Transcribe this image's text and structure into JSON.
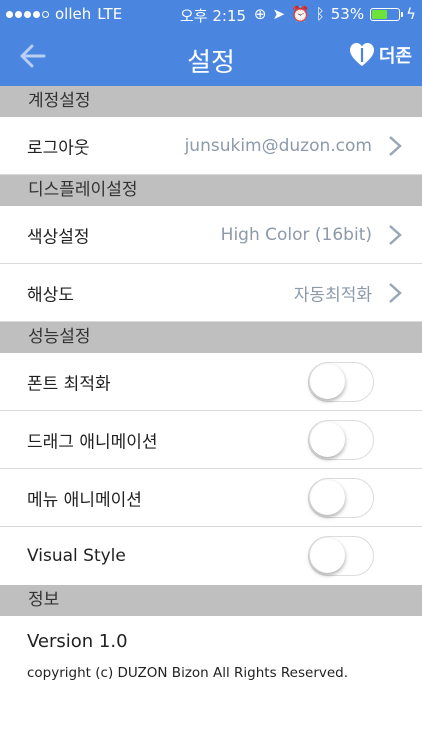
{
  "status_bar": {
    "carrier": "olleh",
    "network": "LTE",
    "time": "오후 2:15",
    "battery": "53%",
    "signal_bars_filled": 4,
    "signal_bars_total": 5
  },
  "nav": {
    "title": "설정",
    "brand": "더존",
    "brand_color": "#4a86e0"
  },
  "sections": {
    "account": "계정설정",
    "display": "디스플레이설정",
    "performance": "성능설정",
    "info": "정보"
  },
  "account": {
    "logout_label": "로그아웃",
    "logout_value": "junsukim@duzon.com"
  },
  "display": {
    "color_label": "색상설정",
    "color_value": "High Color (16bit)",
    "resolution_label": "해상도",
    "resolution_value": "자동최적화"
  },
  "performance": {
    "font_label": "폰트 최적화",
    "font_on": false,
    "drag_label": "드래그 애니메이션",
    "drag_on": false,
    "menu_label": "메뉴 애니메이션",
    "menu_on": false,
    "visual_label": "Visual Style",
    "visual_on": false
  },
  "info": {
    "version": "Version 1.0",
    "copyright": "copyright (c) DUZON Bizon All Rights Reserved."
  }
}
